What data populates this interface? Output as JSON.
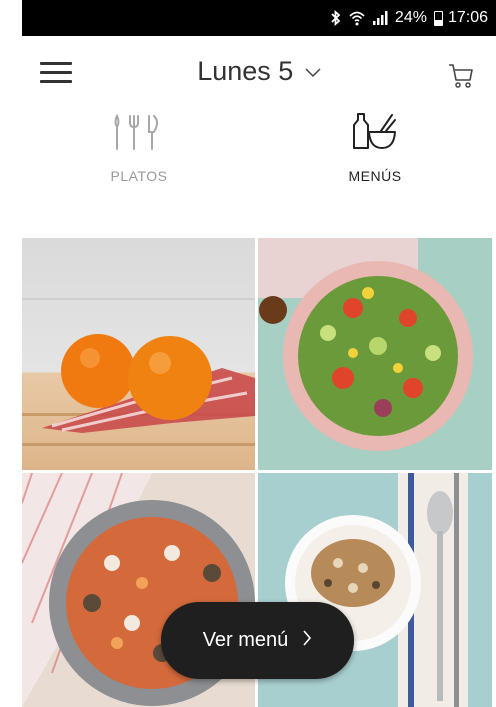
{
  "status_bar": {
    "battery_percent": "24%",
    "time": "17:06"
  },
  "header": {
    "day_title": "Lunes 5"
  },
  "tabs": [
    {
      "label": "PLATOS",
      "active": false
    },
    {
      "label": "MENÚS",
      "active": true
    }
  ],
  "cta": {
    "label": "Ver menú"
  },
  "colors": {
    "header_text": "#333333",
    "tab_inactive": "#9a9a9a",
    "tab_active": "#222222",
    "button_bg": "#1f1f1f"
  },
  "icons": {
    "menu": "hamburger-icon",
    "dropdown": "chevron-down-icon",
    "cart": "cart-icon",
    "platos": "cutlery-icon",
    "menus": "bottle-bowl-icon",
    "cta": "chevron-right-icon"
  },
  "images": [
    "oranges-photo",
    "salad-photo",
    "pasta-photo",
    "yogurt-photo"
  ]
}
